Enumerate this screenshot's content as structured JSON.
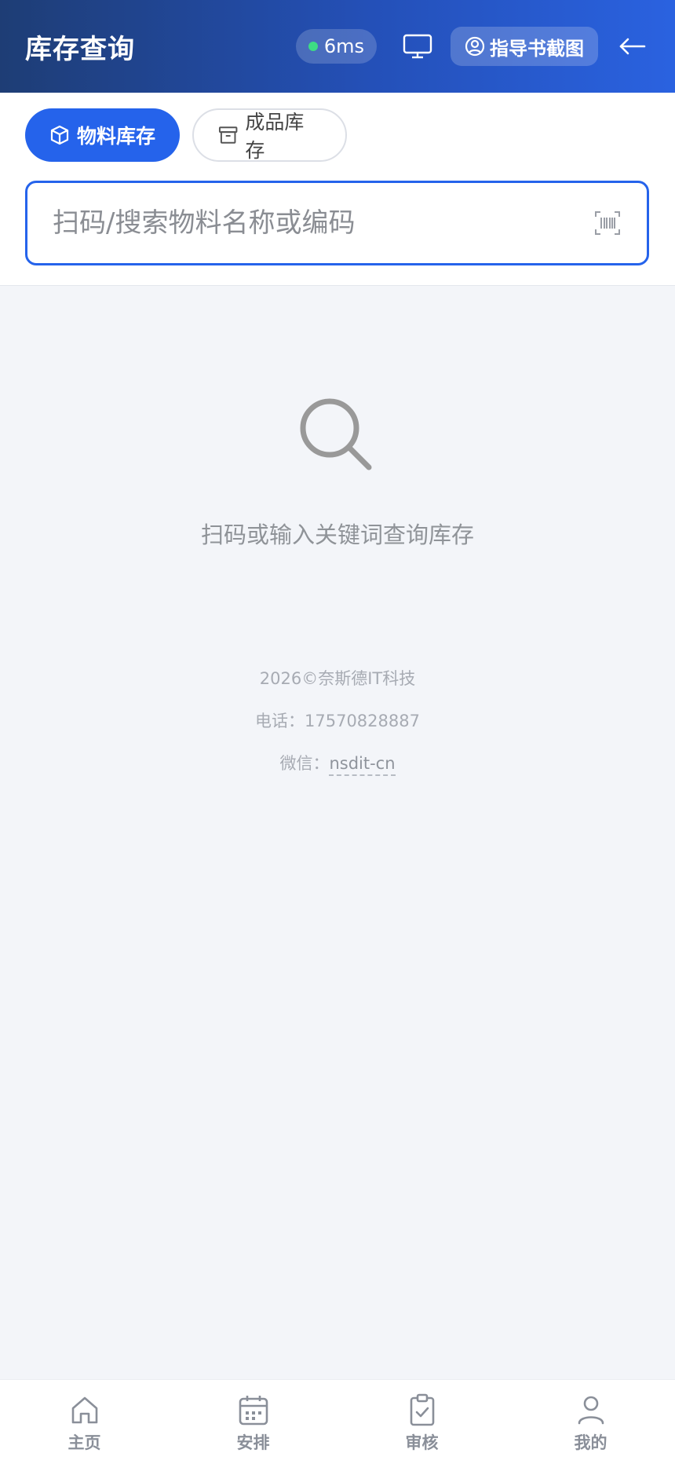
{
  "header": {
    "title": "库存查询",
    "latency": "6ms",
    "guide_label": "指导书截图"
  },
  "tabs": [
    {
      "label": "物料库存",
      "icon": "cube-icon",
      "active": true
    },
    {
      "label": "成品库存",
      "icon": "archive-icon",
      "active": false
    }
  ],
  "search": {
    "placeholder": "扫码/搜索物料名称或编码",
    "value": ""
  },
  "empty": {
    "text": "扫码或输入关键词查询库存"
  },
  "footer": {
    "copyright": "2026©奈斯德IT科技",
    "phone_label": "电话：",
    "phone": "17570828887",
    "wechat_label": "微信：",
    "wechat": "nsdit-cn"
  },
  "tabbar": [
    {
      "label": "主页",
      "icon": "home-icon"
    },
    {
      "label": "安排",
      "icon": "calendar-icon"
    },
    {
      "label": "审核",
      "icon": "clipboard-check-icon"
    },
    {
      "label": "我的",
      "icon": "user-icon"
    }
  ],
  "colors": {
    "accent": "#2563eb",
    "status_online": "#3ddc84"
  }
}
